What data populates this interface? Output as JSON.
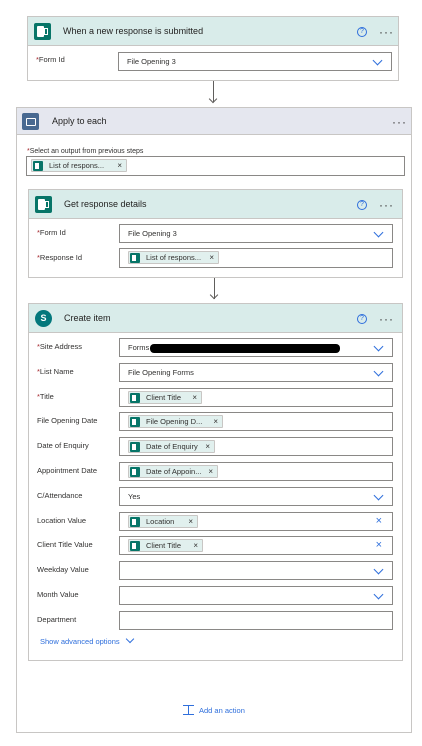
{
  "trigger": {
    "title": "When a new response is submitted",
    "form_id_label": "Form Id",
    "form_id_value": "File Opening 3",
    "help": "?",
    "more": "···"
  },
  "apply": {
    "title": "Apply to each",
    "select_label": "Select an output from previous steps",
    "token": "List of respons...",
    "more": "···"
  },
  "get_details": {
    "title": "Get response details",
    "form_id_label": "Form Id",
    "form_id_value": "File Opening 3",
    "response_id_label": "Response Id",
    "response_token": "List of respons...",
    "help": "?",
    "more": "···"
  },
  "create_item": {
    "title": "Create item",
    "help": "?",
    "more": "···",
    "fields": [
      {
        "label": "Site Address",
        "required": true,
        "value": "Forms -",
        "token": "",
        "control": "dropdown"
      },
      {
        "label": "List Name",
        "required": true,
        "value": "File Opening Forms",
        "token": "",
        "control": "dropdown"
      },
      {
        "label": "Title",
        "required": true,
        "value": "",
        "token": "Client Title",
        "control": "none"
      },
      {
        "label": "File Opening Date",
        "required": false,
        "value": "",
        "token": "File Opening D...",
        "control": "none"
      },
      {
        "label": "Date of Enquiry",
        "required": false,
        "value": "",
        "token": "Date of Enquiry",
        "control": "none"
      },
      {
        "label": "Appointment Date",
        "required": false,
        "value": "",
        "token": "Date of Appoin...",
        "control": "none"
      },
      {
        "label": "C/Attendance",
        "required": false,
        "value": "Yes",
        "token": "",
        "control": "dropdown"
      },
      {
        "label": "Location Value",
        "required": false,
        "value": "",
        "token": "Location",
        "control": "clear"
      },
      {
        "label": "Client Title Value",
        "required": false,
        "value": "",
        "token": "Client Title",
        "control": "clear"
      },
      {
        "label": "Weekday Value",
        "required": false,
        "value": "",
        "token": "",
        "control": "dropdown"
      },
      {
        "label": "Month Value",
        "required": false,
        "value": "",
        "token": "",
        "control": "dropdown"
      },
      {
        "label": "Department",
        "required": false,
        "value": "",
        "token": "",
        "control": "none"
      }
    ],
    "advanced": "Show advanced options"
  },
  "add_action": "Add an action",
  "colors": {
    "forms_header": "#d9ecea",
    "apply_header": "#e5e7ef",
    "token_icon": "#077568",
    "link": "#2f6fdc",
    "required": "#a4262c"
  }
}
